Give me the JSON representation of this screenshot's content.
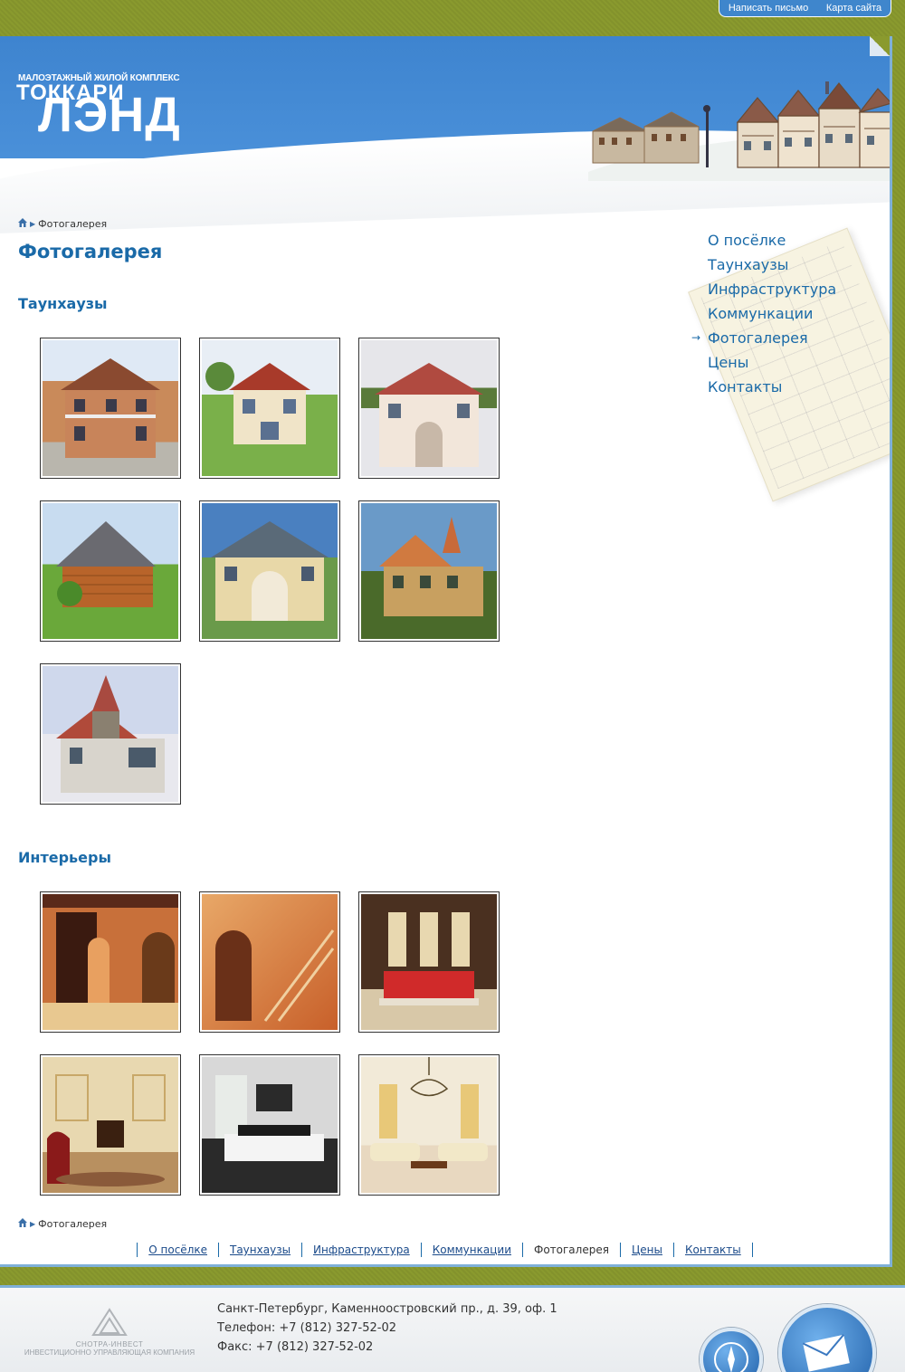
{
  "toplinks": {
    "write": "Написать письмо",
    "sitemap": "Карта сайта"
  },
  "logo": {
    "subtitle": "МАЛОЭТАЖНЫЙ ЖИЛОЙ КОМПЛЕКС",
    "line1": "ТОККАРИ",
    "line2": "ЛЭНД"
  },
  "breadcrumb": {
    "current": "Фотогалерея"
  },
  "page_title": "Фотогалерея",
  "sections": [
    {
      "title": "Таунхаузы",
      "count": 7
    },
    {
      "title": "Интерьеры",
      "count": 6
    }
  ],
  "sidemenu": {
    "items": [
      "О посёлке",
      "Таунхаузы",
      "Инфраструктура",
      "Коммункации",
      "Фотогалерея",
      "Цены",
      "Контакты"
    ],
    "active": "Фотогалерея",
    "arrow": "→"
  },
  "footnav": [
    "О посёлке",
    "Таунхаузы",
    "Инфраструктура",
    "Коммункации",
    "Фотогалерея",
    "Цены",
    "Контакты"
  ],
  "footer": {
    "company_name": "СНОТРА-ИНВЕСТ",
    "company_sub": "ИНВЕСТИЦИОННО УПРАВЛЯЮЩАЯ КОМПАНИЯ",
    "address": "Санкт-Петербург, Каменноостровский пр., д. 39, оф. 1",
    "phone": "Телефон: +7 (812) 327-52-02",
    "fax": "Факс: +7 (812) 327-52-02"
  },
  "colors": {
    "accent": "#1a6aa8",
    "header_blue": "#4a90d9",
    "page_bg": "#8a9a2e"
  }
}
